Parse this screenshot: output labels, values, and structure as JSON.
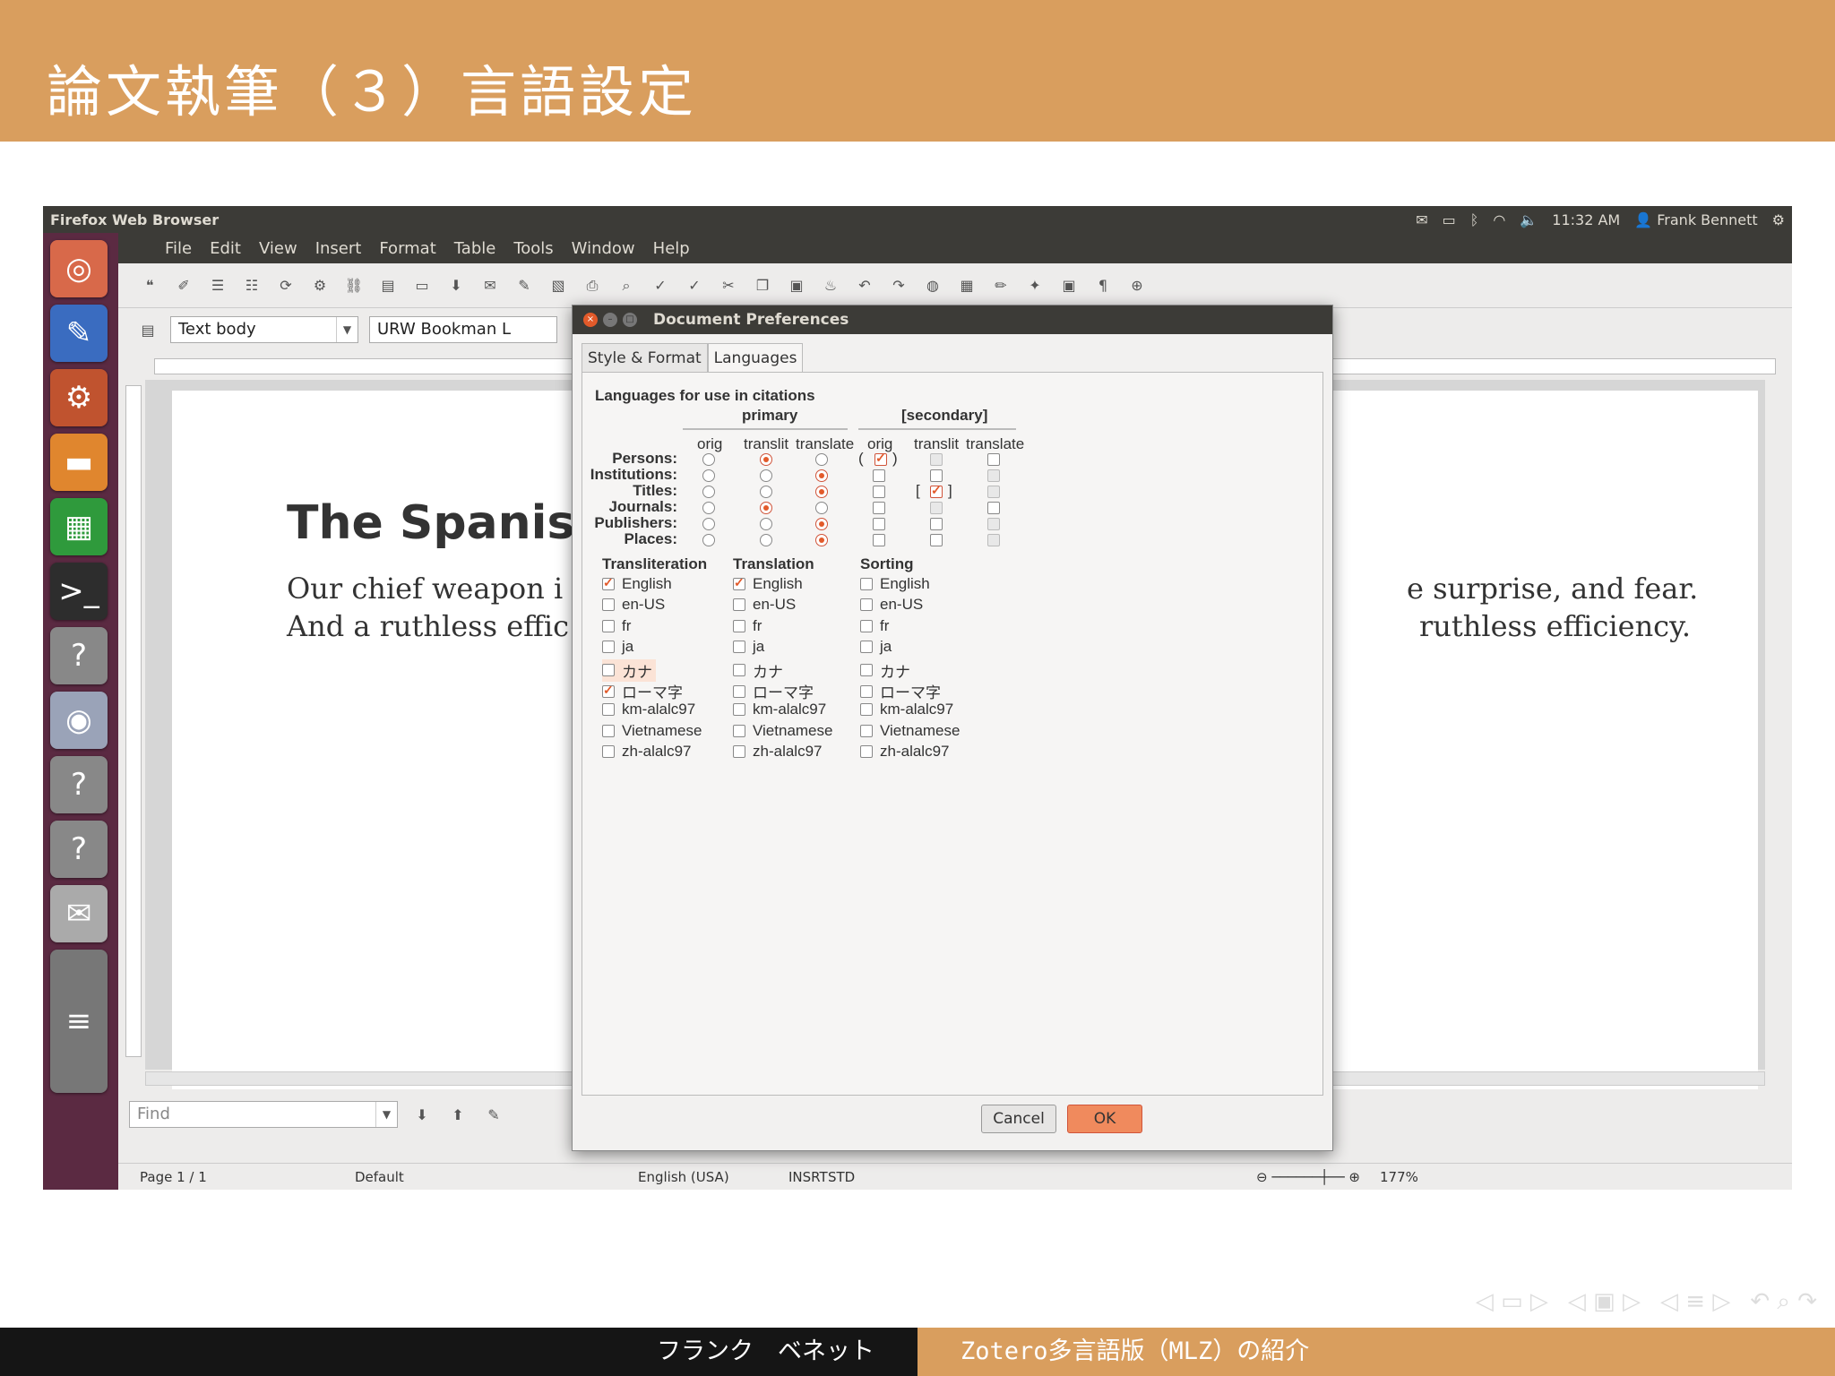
{
  "slide": {
    "title": "論文執筆（３）言語設定",
    "footer_left": "フランク　ベネット",
    "footer_right": "Zotero多言語版（MLZ）の紹介"
  },
  "topbar": {
    "app_name": "Firefox Web Browser",
    "time": "11:32 AM",
    "user": "Frank Bennett"
  },
  "menu": [
    "File",
    "Edit",
    "View",
    "Insert",
    "Format",
    "Table",
    "Tools",
    "Window",
    "Help"
  ],
  "format": {
    "paragraph_style": "Text body",
    "font_name": "URW Bookman L"
  },
  "document": {
    "heading": "The Spanis",
    "line1_left": "Our chief weapon i",
    "line2_left": "And a ruthless effic",
    "line1_right": "e surprise, and fear.",
    "line2_right": "ruthless efficiency."
  },
  "find": {
    "placeholder": "Find"
  },
  "status": {
    "page": "Page 1 / 1",
    "style": "Default",
    "language": "English (USA)",
    "insert": "INSRT",
    "selection": "STD",
    "zoom": "177%"
  },
  "dialog": {
    "title": "Document Preferences",
    "tabs": [
      "Style & Format",
      "Languages"
    ],
    "section_title": "Languages for use in citations",
    "primary_label": "primary",
    "secondary_label": "[secondary]",
    "columns": [
      "orig",
      "translit",
      "translate",
      "orig",
      "translit",
      "translate"
    ],
    "rows": [
      "Persons:",
      "Institutions:",
      "Titles:",
      "Journals:",
      "Publishers:",
      "Places:"
    ],
    "groups": {
      "transliteration": "Transliteration",
      "translation": "Translation",
      "sorting": "Sorting"
    },
    "languages": [
      "English",
      "en-US",
      "fr",
      "ja",
      "カナ",
      "ローマ字",
      "km-alalc97",
      "Vietnamese",
      "zh-alalc97"
    ],
    "transliteration_checked": [
      0,
      5
    ],
    "translation_checked": [
      0
    ],
    "sorting_checked": [],
    "cancel_label": "Cancel",
    "ok_label": "OK"
  },
  "colors": {
    "accent": "#d99e5e",
    "ubuntu_orange": "#e25a2a",
    "launcher": "#5b2a42"
  }
}
